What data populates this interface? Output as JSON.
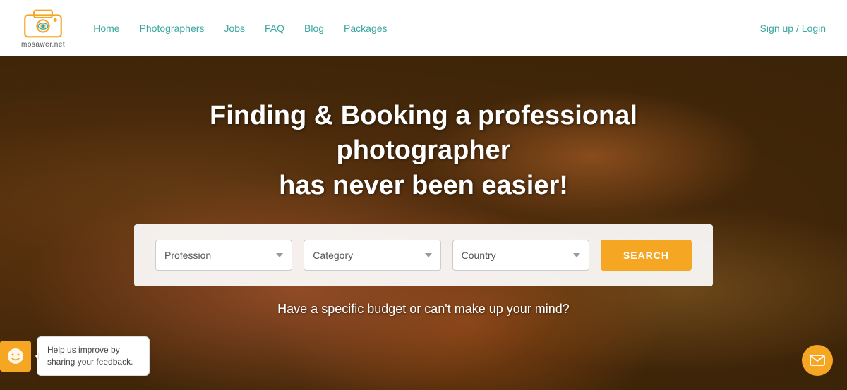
{
  "header": {
    "logo_text": "mosawer.net",
    "nav_items": [
      {
        "label": "Home",
        "href": "#"
      },
      {
        "label": "Photographers",
        "href": "#"
      },
      {
        "label": "Jobs",
        "href": "#"
      },
      {
        "label": "FAQ",
        "href": "#"
      },
      {
        "label": "Blog",
        "href": "#"
      },
      {
        "label": "Packages",
        "href": "#"
      }
    ],
    "signup_label": "Sign up / Login"
  },
  "hero": {
    "title_line1": "Finding & Booking a professional photographer",
    "title_line2": "has never been easier!",
    "search": {
      "profession_label": "Profession",
      "category_label": "Category",
      "country_label": "Country",
      "button_label": "SEARCH"
    },
    "bottom_text": "Have a specific budget or can't make up your mind?"
  },
  "feedback": {
    "text": "Help us improve by sharing your feedback.",
    "icon": "smiley-face"
  },
  "mail": {
    "icon": "envelope-icon"
  }
}
